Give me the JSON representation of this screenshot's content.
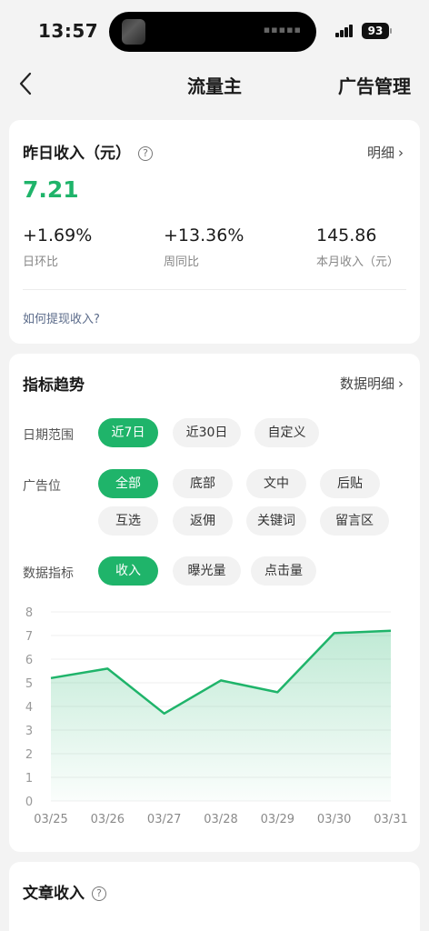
{
  "status_bar": {
    "time": "13:57",
    "battery": "93"
  },
  "nav": {
    "title": "流量主",
    "right_action": "广告管理"
  },
  "income_card": {
    "title": "昨日收入（元）",
    "detail_link": "明细",
    "value": "7.21",
    "stats": [
      {
        "value": "+1.69%",
        "label": "日环比"
      },
      {
        "value": "+13.36%",
        "label": "周同比"
      },
      {
        "value": "145.86",
        "label": "本月收入（元）"
      }
    ],
    "withdraw_link": "如何提现收入?"
  },
  "trend_card": {
    "title": "指标趋势",
    "detail_link": "数据明细",
    "date_range": {
      "label": "日期范围",
      "options": [
        "近7日",
        "近30日",
        "自定义"
      ],
      "selected": "近7日"
    },
    "ad_position": {
      "label": "广告位",
      "options": [
        "全部",
        "底部",
        "文中",
        "后贴",
        "互选",
        "返佣",
        "关键词",
        "留言区"
      ],
      "selected": "全部"
    },
    "metric": {
      "label": "数据指标",
      "options": [
        "收入",
        "曝光量",
        "点击量"
      ],
      "selected": "收入"
    }
  },
  "chart_data": {
    "type": "area",
    "categories": [
      "03/25",
      "03/26",
      "03/27",
      "03/28",
      "03/29",
      "03/30",
      "03/31"
    ],
    "values": [
      5.2,
      5.6,
      3.7,
      5.1,
      4.6,
      7.1,
      7.2
    ],
    "ylim": [
      0,
      8
    ],
    "yticks": [
      "0",
      "1",
      "2",
      "3",
      "4",
      "5",
      "6",
      "7",
      "8"
    ],
    "grid": true,
    "line_color": "#1fb46a"
  },
  "article_card": {
    "title": "文章收入"
  },
  "colors": {
    "accent": "#1fb46a",
    "background": "#f3f3f3"
  }
}
